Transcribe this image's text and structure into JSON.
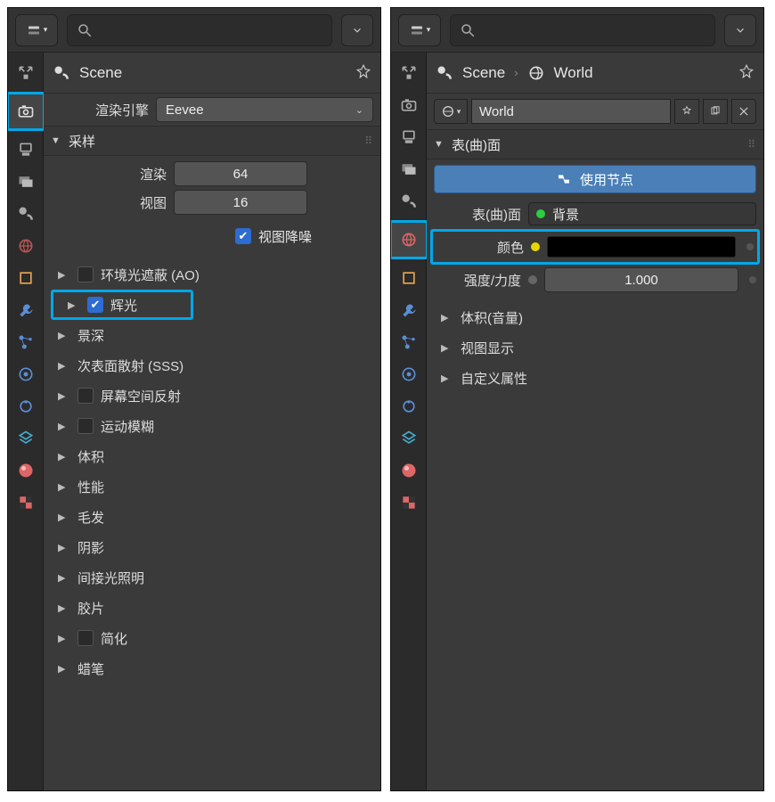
{
  "left": {
    "breadcrumb": {
      "scene": "Scene"
    },
    "render_engine_label": "渲染引擎",
    "render_engine_value": "Eevee",
    "sampling_header": "采样",
    "render_samples_label": "渲染",
    "render_samples_value": "64",
    "viewport_samples_label": "视图",
    "viewport_samples_value": "16",
    "viewport_denoise_label": "视图降噪",
    "sections": [
      {
        "label": "环境光遮蔽 (AO)",
        "checked": false
      },
      {
        "label": "辉光",
        "checked": true
      },
      {
        "label": "景深",
        "checked": null
      },
      {
        "label": "次表面散射 (SSS)",
        "checked": null
      },
      {
        "label": "屏幕空间反射",
        "checked": false
      },
      {
        "label": "运动模糊",
        "checked": false
      },
      {
        "label": "体积",
        "checked": null
      },
      {
        "label": "性能",
        "checked": null
      },
      {
        "label": "毛发",
        "checked": null
      },
      {
        "label": "阴影",
        "checked": null
      },
      {
        "label": "间接光照明",
        "checked": null
      },
      {
        "label": "胶片",
        "checked": null
      },
      {
        "label": "简化",
        "checked": false
      },
      {
        "label": "蜡笔",
        "checked": null
      }
    ]
  },
  "right": {
    "breadcrumb": {
      "scene": "Scene",
      "world": "World"
    },
    "datablock_name": "World",
    "surface_header": "表(曲)面",
    "use_nodes_label": "使用节点",
    "surface_label": "表(曲)面",
    "surface_shader": "背景",
    "color_label": "颜色",
    "strength_label": "强度/力度",
    "strength_value": "1.000",
    "sections": [
      {
        "label": "体积(音量)"
      },
      {
        "label": "视图显示"
      },
      {
        "label": "自定义属性"
      }
    ]
  }
}
